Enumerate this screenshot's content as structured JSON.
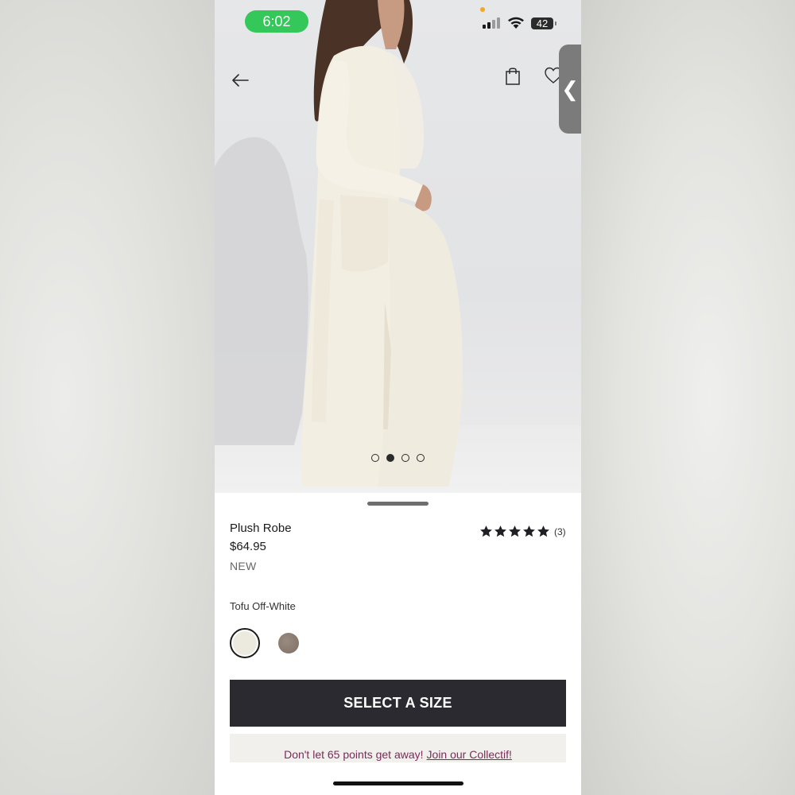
{
  "status_bar": {
    "time": "6:02",
    "battery": "42"
  },
  "nav": {
    "back_icon": "arrow-left-icon",
    "bag_icon": "shopping-bag-icon",
    "wishlist_icon": "heart-icon",
    "side_tab_glyph": "❮"
  },
  "gallery": {
    "image_count": 4,
    "active_index": 1
  },
  "product": {
    "name": "Plush Robe",
    "price": "$64.95",
    "badge": "NEW",
    "rating": 5,
    "review_count": "(3)",
    "color_name": "Tofu Off-White",
    "swatches": [
      "#ece9df",
      "#8a7b70"
    ],
    "selected_swatch": 0
  },
  "cta": {
    "label": "SELECT A SIZE"
  },
  "promo": {
    "text": "Don't let 65 points get away!",
    "link": "Join our Collectif!"
  },
  "colors": {
    "status_green": "#34c759",
    "cta_bg": "#2b2a30",
    "promo_text": "#7a2b5b",
    "promo_bg": "#f1f0ec"
  }
}
